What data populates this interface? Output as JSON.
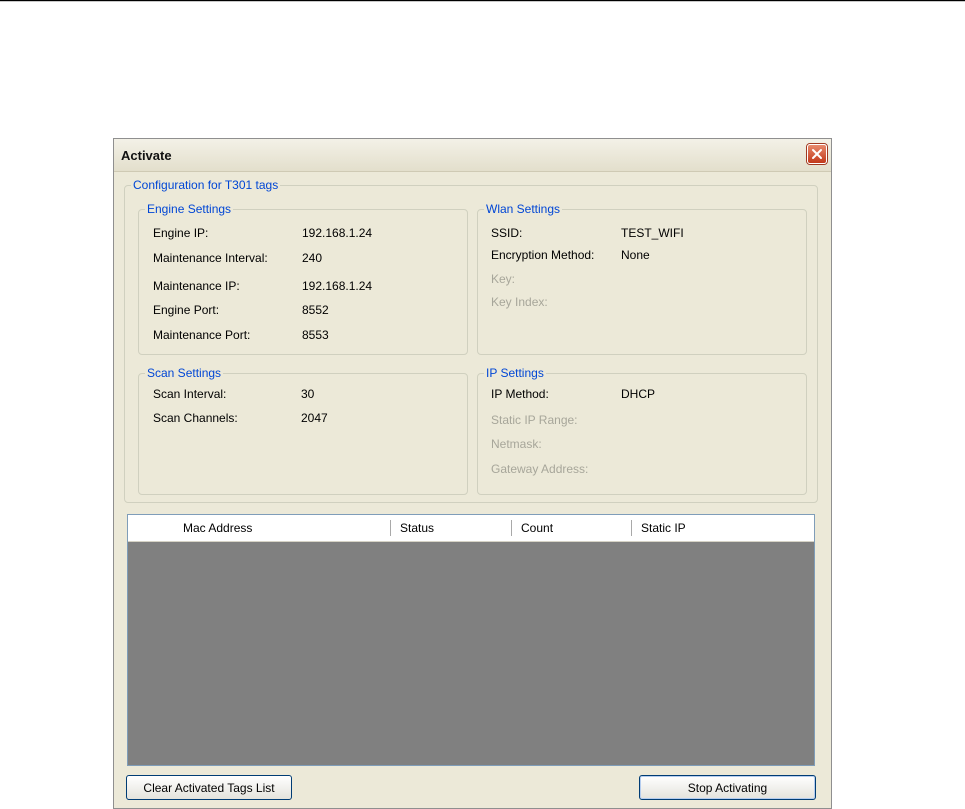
{
  "dialog": {
    "title": "Activate",
    "close_icon": "close-icon"
  },
  "config": {
    "legend": "Configuration for T301 tags",
    "engine": {
      "legend": "Engine Settings",
      "rows": [
        {
          "label": "Engine IP:",
          "value": "192.168.1.24"
        },
        {
          "label": "Maintenance Interval:",
          "value": "240"
        },
        {
          "label": "Maintenance IP:",
          "value": "192.168.1.24"
        },
        {
          "label": "Engine Port:",
          "value": "8552"
        },
        {
          "label": "Maintenance Port:",
          "value": "8553"
        }
      ]
    },
    "wlan": {
      "legend": "Wlan Settings",
      "rows": [
        {
          "label": "SSID:",
          "value": "TEST_WIFI"
        },
        {
          "label": "Encryption Method:",
          "value": "None"
        },
        {
          "label": "Key:",
          "value": ""
        },
        {
          "label": "Key Index:",
          "value": ""
        }
      ]
    },
    "scan": {
      "legend": "Scan Settings",
      "rows": [
        {
          "label": "Scan Interval:",
          "value": "30"
        },
        {
          "label": "Scan Channels:",
          "value": "2047"
        }
      ]
    },
    "ip": {
      "legend": "IP Settings",
      "rows": [
        {
          "label": "IP Method:",
          "value": "DHCP"
        },
        {
          "label": "Static IP Range:",
          "value": ""
        },
        {
          "label": "Netmask:",
          "value": ""
        },
        {
          "label": "Gateway Address:",
          "value": ""
        }
      ]
    }
  },
  "table": {
    "columns": [
      "Mac Address",
      "Status",
      "Count",
      "Static IP"
    ],
    "rows": []
  },
  "buttons": {
    "clear": "Clear Activated Tags List",
    "stop": "Stop Activating"
  },
  "colors": {
    "group_legend": "#0046d5",
    "disabled_text": "#a7a69a",
    "grid_background": "#808080"
  }
}
